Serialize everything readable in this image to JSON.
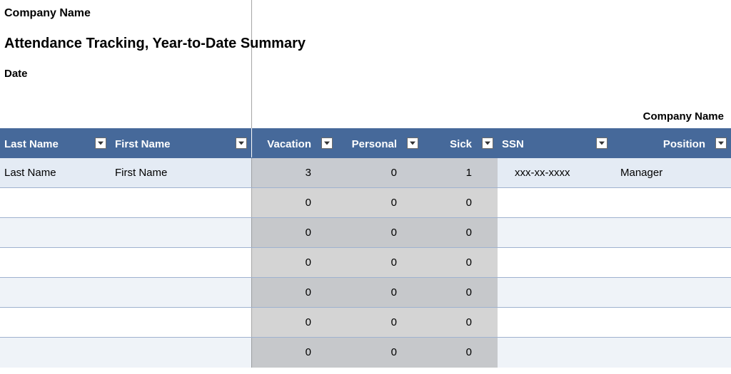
{
  "header": {
    "company_name_top": "Company Name",
    "title": "Attendance Tracking, Year-to-Date Summary",
    "date_label": "Date",
    "company_name_right": "Company Name"
  },
  "table": {
    "columns": {
      "last_name": "Last Name",
      "first_name": "First Name",
      "vacation": "Vacation",
      "personal": "Personal",
      "sick": "Sick",
      "ssn": "SSN",
      "position": "Position"
    },
    "rows": [
      {
        "last_name": "Last Name",
        "first_name": "First Name",
        "vacation": "3",
        "personal": "0",
        "sick": "1",
        "ssn": "xxx-xx-xxxx",
        "position": "Manager"
      },
      {
        "last_name": "",
        "first_name": "",
        "vacation": "0",
        "personal": "0",
        "sick": "0",
        "ssn": "",
        "position": ""
      },
      {
        "last_name": "",
        "first_name": "",
        "vacation": "0",
        "personal": "0",
        "sick": "0",
        "ssn": "",
        "position": ""
      },
      {
        "last_name": "",
        "first_name": "",
        "vacation": "0",
        "personal": "0",
        "sick": "0",
        "ssn": "",
        "position": ""
      },
      {
        "last_name": "",
        "first_name": "",
        "vacation": "0",
        "personal": "0",
        "sick": "0",
        "ssn": "",
        "position": ""
      },
      {
        "last_name": "",
        "first_name": "",
        "vacation": "0",
        "personal": "0",
        "sick": "0",
        "ssn": "",
        "position": ""
      },
      {
        "last_name": "",
        "first_name": "",
        "vacation": "0",
        "personal": "0",
        "sick": "0",
        "ssn": "",
        "position": ""
      }
    ]
  }
}
